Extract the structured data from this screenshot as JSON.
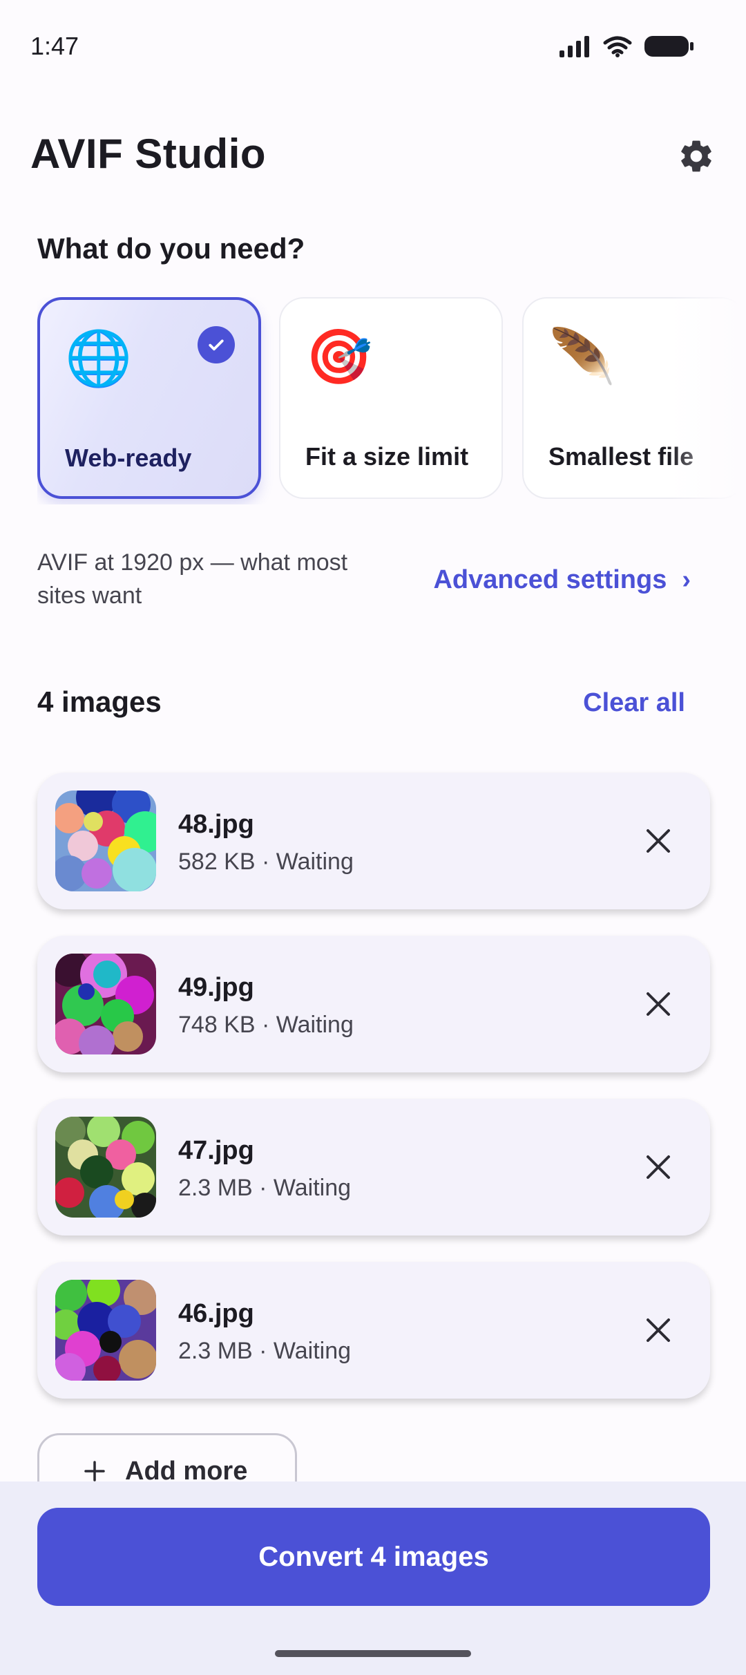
{
  "status_bar": {
    "time": "1:47"
  },
  "app": {
    "title": "AVIF Studio"
  },
  "section": {
    "question": "What do you need?"
  },
  "presets": [
    {
      "label": "Web-ready",
      "emoji": "🌐",
      "selected": true
    },
    {
      "label": "Fit a size limit",
      "emoji": "🎯",
      "selected": false
    },
    {
      "label": "Smallest file",
      "emoji": "🪶",
      "selected": false
    }
  ],
  "preset_description": "AVIF at 1920 px — what most sites want",
  "advanced": {
    "label": "Advanced settings",
    "chevron": "›"
  },
  "images_header": {
    "count_label": "4 images",
    "clear_label": "Clear all"
  },
  "files": [
    {
      "name": "48.jpg",
      "meta": "582 KB · Waiting"
    },
    {
      "name": "49.jpg",
      "meta": "748 KB · Waiting"
    },
    {
      "name": "47.jpg",
      "meta": "2.3 MB · Waiting"
    },
    {
      "name": "46.jpg",
      "meta": "2.3 MB · Waiting"
    }
  ],
  "add_more": {
    "label": "Add more"
  },
  "convert": {
    "label": "Convert 4 images"
  },
  "colors": {
    "accent": "#4b51d6",
    "card_bg": "#f4f2fb",
    "selected_bg": "#e2e3fb"
  }
}
